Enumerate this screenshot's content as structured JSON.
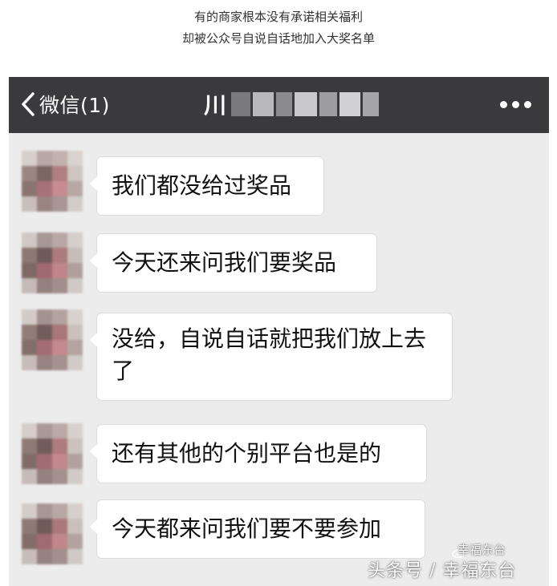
{
  "caption": {
    "line1": "有的商家根本没有承诺相关福利",
    "line2": "却被公众号自说自话地加入大奖名单"
  },
  "navbar": {
    "back_label": "微信(1)",
    "title": "川",
    "back_icon": "chevron-left-icon",
    "more_icon": "more-dots-icon",
    "background": "#3a3a3c"
  },
  "messages": [
    {
      "text": "我们都没给过奖品"
    },
    {
      "text": "今天还来问我们要奖品"
    },
    {
      "text": "没给，自说自话就把我们放上去了"
    },
    {
      "text": "还有其他的个别平台也是的"
    },
    {
      "text": "今天都来问我们要不要参加"
    }
  ],
  "watermark": {
    "text": "头条号 / 幸福东台",
    "logo_text": "幸福东台"
  },
  "colors": {
    "chat_bg": "#ececec",
    "bubble_bg": "#ffffff",
    "text": "#111111"
  }
}
